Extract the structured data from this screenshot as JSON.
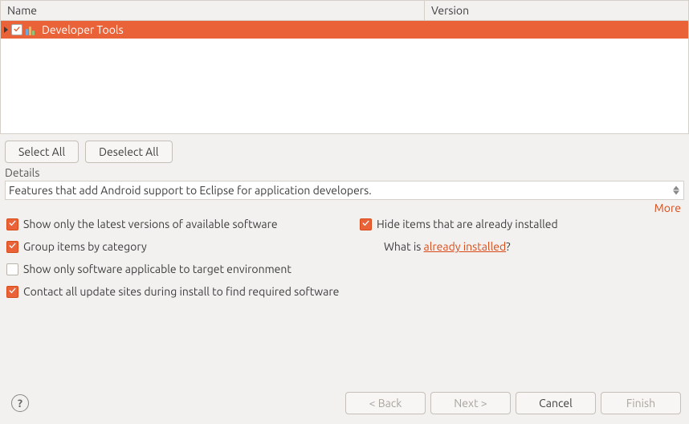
{
  "table": {
    "headers": {
      "name": "Name",
      "version": "Version"
    },
    "rows": [
      {
        "label": "Developer Tools",
        "checked": true,
        "selected": true
      }
    ]
  },
  "buttons": {
    "select_all": "Select All",
    "deselect_all": "Deselect All"
  },
  "details": {
    "label": "Details",
    "text": "Features that add Android support to Eclipse for application developers.",
    "more": "More"
  },
  "options": {
    "latest_versions": "Show only the latest versions of available software",
    "group_by_category": "Group items by category",
    "applicable_target": "Show only software applicable to target environment",
    "contact_update_sites": "Contact all update sites during install to find required software",
    "hide_installed": "Hide items that are already installed",
    "whatis_prefix": "What is ",
    "whatis_link": "already installed",
    "whatis_suffix": "?"
  },
  "footer": {
    "back": "< Back",
    "next": "Next >",
    "cancel": "Cancel",
    "finish": "Finish"
  }
}
